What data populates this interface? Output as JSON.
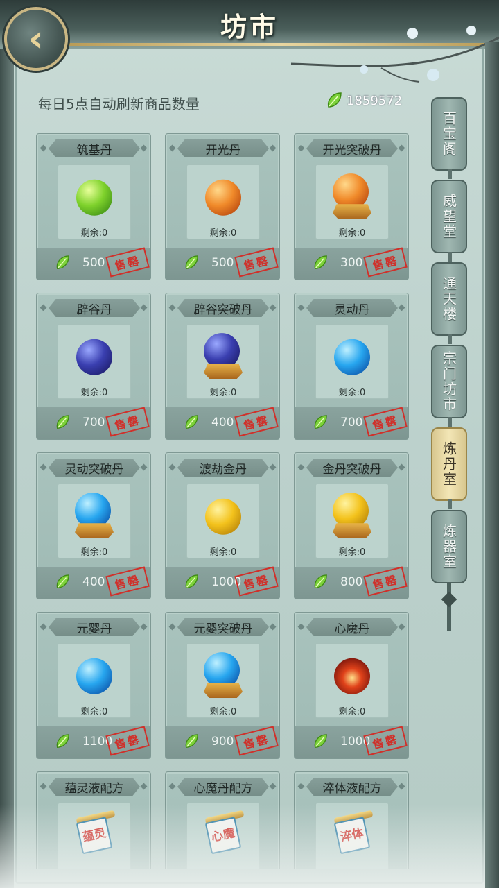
{
  "header": {
    "title": "坊市",
    "back_icon": "back-arrow-icon"
  },
  "info": {
    "refresh_note": "每日5点自动刷新商品数量",
    "currency_amount": "1859572",
    "currency_icon": "jade-leaf-icon"
  },
  "sold_label": "售罄",
  "items": [
    {
      "name": "筑基丹",
      "remain": "剩余:0",
      "price": "500",
      "pill": "green",
      "base": false
    },
    {
      "name": "开光丹",
      "remain": "剩余:0",
      "price": "500",
      "pill": "orange",
      "base": false
    },
    {
      "name": "开光突破丹",
      "remain": "剩余:0",
      "price": "300",
      "pill": "orange",
      "base": true
    },
    {
      "name": "辟谷丹",
      "remain": "剩余:0",
      "price": "700",
      "pill": "purple",
      "base": false
    },
    {
      "name": "辟谷突破丹",
      "remain": "剩余:0",
      "price": "400",
      "pill": "purple",
      "base": true
    },
    {
      "name": "灵动丹",
      "remain": "剩余:0",
      "price": "700",
      "pill": "blue",
      "base": false
    },
    {
      "name": "灵动突破丹",
      "remain": "剩余:0",
      "price": "400",
      "pill": "blue",
      "base": true
    },
    {
      "name": "渡劫金丹",
      "remain": "剩余:0",
      "price": "1000",
      "pill": "gold",
      "base": false
    },
    {
      "name": "金丹突破丹",
      "remain": "剩余:0",
      "price": "800",
      "pill": "gold",
      "base": true
    },
    {
      "name": "元婴丹",
      "remain": "剩余:0",
      "price": "1100",
      "pill": "blue",
      "base": false
    },
    {
      "name": "元婴突破丹",
      "remain": "剩余:0",
      "price": "900",
      "pill": "blue",
      "base": true
    },
    {
      "name": "心魔丹",
      "remain": "剩余:0",
      "price": "1000",
      "pill": "red",
      "base": false
    },
    {
      "name": "蕴灵液配方",
      "scroll_text": "蕴灵",
      "pill": "scroll"
    },
    {
      "name": "心魔丹配方",
      "scroll_text": "心魔",
      "pill": "scroll"
    },
    {
      "name": "淬体液配方",
      "scroll_text": "淬体",
      "pill": "scroll"
    }
  ],
  "side_tabs": [
    {
      "label": "百宝阁",
      "active": false
    },
    {
      "label": "威望堂",
      "active": false
    },
    {
      "label": "通天楼",
      "active": false
    },
    {
      "label": "宗门坊市",
      "active": false
    },
    {
      "label": "炼丹室",
      "active": true
    },
    {
      "label": "炼器室",
      "active": false
    }
  ],
  "colors": {
    "sold_red": "#d0302a",
    "active_tab": "#f3e6b6",
    "panel": "#c9dbd6"
  }
}
